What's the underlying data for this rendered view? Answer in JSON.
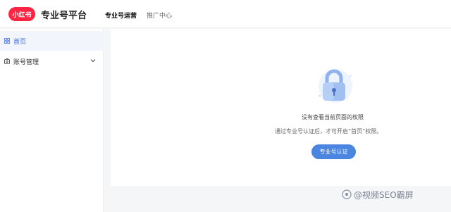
{
  "header": {
    "logo_text": "小红书",
    "platform_title": "专业号平台",
    "tabs": [
      {
        "label": "专业号运营"
      },
      {
        "label": "推广中心"
      }
    ]
  },
  "sidebar": {
    "items": [
      {
        "label": "首页",
        "icon": "grid-icon"
      },
      {
        "label": "账号管理",
        "icon": "account-icon"
      }
    ]
  },
  "content": {
    "icon": "lock-icon",
    "message": "没有查看当前页面的权限",
    "hint": "通过专业号认证后，才可开启“首页”权限。",
    "button_label": "专业号认证"
  },
  "watermark": {
    "text": "@视频SEO霸屏"
  },
  "colors": {
    "brand": "#ff2442",
    "accent": "#4a86e0"
  }
}
